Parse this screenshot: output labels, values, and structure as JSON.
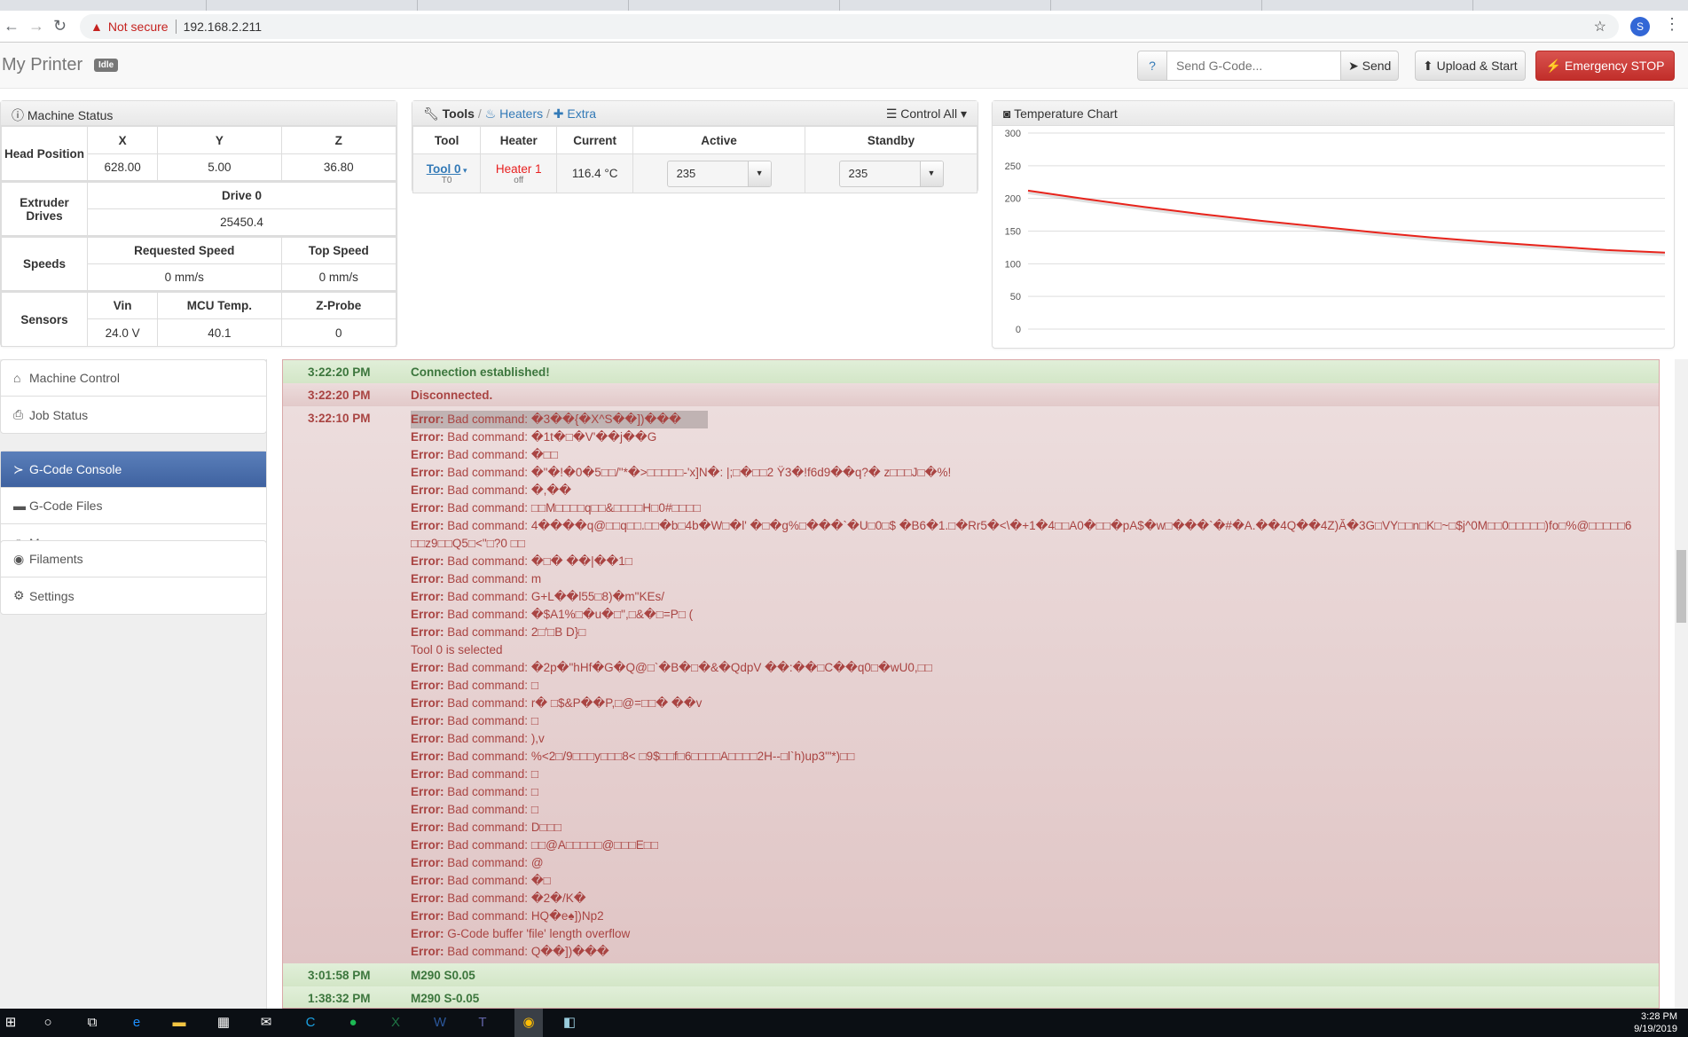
{
  "browser": {
    "security": "Not secure",
    "url": "192.168.2.211",
    "profile_initial": "S"
  },
  "navbar": {
    "title": "My Printer",
    "status": "Idle",
    "help": "?",
    "gcode_placeholder": "Send G-Code...",
    "send": "Send",
    "upload": "Upload & Start",
    "estop": "Emergency STOP"
  },
  "machine_status": {
    "title": "Machine Status",
    "head_label": "Head Position",
    "axes": [
      "X",
      "Y",
      "Z"
    ],
    "positions": [
      "628.00",
      "5.00",
      "36.80"
    ],
    "extruder_label": "Extruder Drives",
    "drive_header": "Drive 0",
    "drive_value": "25450.4",
    "speeds_label": "Speeds",
    "speed_headers": [
      "Requested Speed",
      "Top Speed"
    ],
    "speed_values": [
      "0 mm/s",
      "0 mm/s"
    ],
    "sensors_label": "Sensors",
    "sensor_headers": [
      "Vin",
      "MCU Temp.",
      "Z-Probe"
    ],
    "sensor_values": [
      "24.0 V",
      "40.1",
      "0"
    ]
  },
  "tools": {
    "title": "Tools",
    "heaters": "Heaters",
    "extra": "Extra",
    "control_all": "Control All",
    "headers": [
      "Tool",
      "Heater",
      "Current",
      "Active",
      "Standby"
    ],
    "row": {
      "tool": "Tool 0",
      "tool_sub": "T0",
      "heater": "Heater 1",
      "heater_state": "off",
      "current": "116.4 °C",
      "active": "235",
      "standby": "235"
    }
  },
  "temp_chart": {
    "title": "Temperature Chart"
  },
  "chart_data": {
    "type": "line",
    "title": "",
    "ylim": [
      0,
      300
    ],
    "yticks": [
      "300",
      "250",
      "200",
      "150",
      "100",
      "50",
      "0"
    ],
    "grid": true,
    "series": [
      {
        "color": "#e8241c",
        "values": [
          212,
          199,
          187,
          176,
          166,
          157,
          148,
          140,
          133,
          127,
          121,
          117
        ]
      }
    ]
  },
  "sidebar": {
    "groups": [
      [
        {
          "label": "Machine Control",
          "icon": "home-icon"
        },
        {
          "label": "Job Status",
          "icon": "print-icon"
        }
      ],
      [
        {
          "label": "G-Code Console",
          "icon": "terminal-icon",
          "active": true
        },
        {
          "label": "G-Code Files",
          "icon": "hdd-icon"
        },
        {
          "label": "Macros",
          "icon": "link-icon"
        }
      ],
      [
        {
          "label": "Filaments",
          "icon": "cd-icon"
        },
        {
          "label": "Settings",
          "icon": "cog-icon"
        }
      ]
    ]
  },
  "console": {
    "messages": [
      {
        "time": "3:22:20 PM",
        "type": "success",
        "text": "Connection established!"
      },
      {
        "time": "3:22:20 PM",
        "type": "warning",
        "text": "Disconnected."
      },
      {
        "time": "3:22:10 PM",
        "type": "error",
        "lines": [
          {
            "p": "Error:",
            "t": " Bad command: �3��{�X^S��])���"
          },
          {
            "p": "Error:",
            "t": " Bad command: �1t�□�V'��j��G"
          },
          {
            "p": "Error:",
            "t": " Bad command: �□□"
          },
          {
            "p": "Error:",
            "t": " Bad command: �\"�!�0�5□□/\"*�>□□□□□-'x]N�: |;□�□□2 Ÿ3�!f6d9��q?� z□□□J□�%!"
          },
          {
            "p": "Error:",
            "t": " Bad command: �,��"
          },
          {
            "p": "Error:",
            "t": " Bad command: □□M□□□□q□□&□□□□H□0#□□□□"
          },
          {
            "p": "Error:",
            "t": " Bad command: 4����q@□□q□□.□□�b□4b�W□�l' �□�g%□���`�U□0□$ �B6�1.□�Rr5�<\\�+1�4□□A0�□□�pA$�w□���`�#�A.��4Q��4Z)Ă�3G□VY□□n□K□~□$j^0M□□0□□□□□)fo□%@□□□□□6□□z9□□Q5□<\"□?0 □□"
          },
          {
            "p": "Error:",
            "t": " Bad command: �□� ��|��1□"
          },
          {
            "p": "Error:",
            "t": " Bad command: m"
          },
          {
            "p": "Error:",
            "t": " Bad command: G+L��l55□8)�m\"KEs/"
          },
          {
            "p": "Error:",
            "t": " Bad command: �$A1%□�u�□\",□&�□=P□ ("
          },
          {
            "p": "Error:",
            "t": " Bad command: 2□'□B D}□"
          },
          {
            "p": "",
            "t": "Tool 0 is selected"
          },
          {
            "p": "Error:",
            "t": " Bad command: �2p�\"hHf�G�Q@□`�B�□�&�QdpV ��:��□C��q0□�wU0,□□"
          },
          {
            "p": "Error:",
            "t": " Bad command: □"
          },
          {
            "p": "Error:",
            "t": " Bad command: r� □$&P��P,□@=□□� ��v"
          },
          {
            "p": "Error:",
            "t": " Bad command: □"
          },
          {
            "p": "Error:",
            "t": " Bad command: ),v"
          },
          {
            "p": "Error:",
            "t": " Bad command: %<2□/9□□□y□□□8< □9$□□f□6□□□□A□□□□2H--□l`h)up3'\"*)□□"
          },
          {
            "p": "Error:",
            "t": " Bad command: □"
          },
          {
            "p": "Error:",
            "t": " Bad command: □"
          },
          {
            "p": "Error:",
            "t": " Bad command: □"
          },
          {
            "p": "Error:",
            "t": " Bad command: D□□□"
          },
          {
            "p": "Error:",
            "t": " Bad command: □□@A□□□□□@□□□E□□"
          },
          {
            "p": "Error:",
            "t": " Bad command: @"
          },
          {
            "p": "Error:",
            "t": " Bad command: �□"
          },
          {
            "p": "Error:",
            "t": " Bad command: �2�/K�"
          },
          {
            "p": "Error:",
            "t": " Bad command: HQ�e♠])Np2"
          },
          {
            "p": "Error:",
            "t": " G-Code buffer 'file' length overflow"
          },
          {
            "p": "Error:",
            "t": " Bad command: Q��])���"
          }
        ]
      },
      {
        "time": "3:01:58 PM",
        "type": "success",
        "text": "M290 S0.05"
      },
      {
        "time": "1:38:32 PM",
        "type": "success",
        "text": "M290 S-0.05"
      }
    ]
  },
  "taskbar": {
    "time": "3:28 PM",
    "date": "9/19/2019"
  }
}
